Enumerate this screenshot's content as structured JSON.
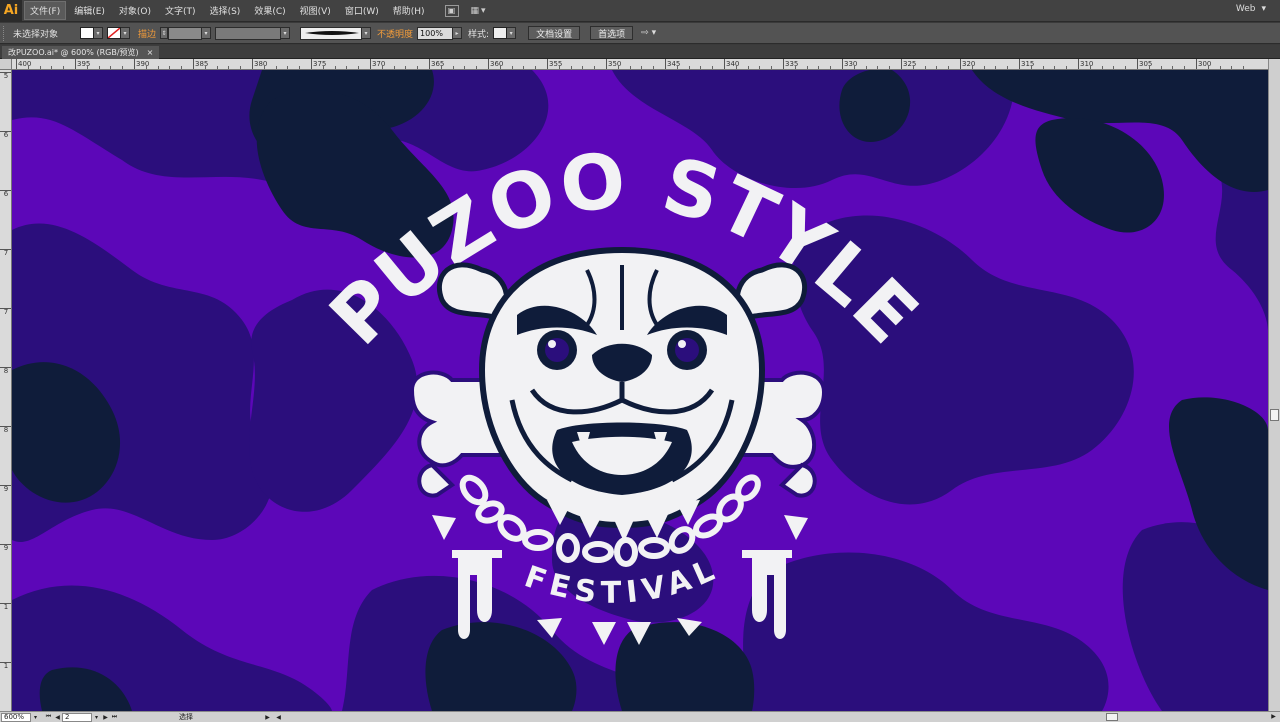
{
  "app": {
    "logo": "Ai"
  },
  "menu": {
    "items": [
      "文件(F)",
      "编辑(E)",
      "对象(O)",
      "文字(T)",
      "选择(S)",
      "效果(C)",
      "视图(V)",
      "窗口(W)",
      "帮助(H)"
    ],
    "active_index": 0,
    "workspace": "Web"
  },
  "control": {
    "selection_label": "未选择对象",
    "stroke_label": "描边",
    "opacity_label": "不透明度",
    "opacity_value": "100%",
    "style_label": "样式:",
    "doc_setup_button": "文档设置",
    "preferences_button": "首选项"
  },
  "tab": {
    "title": "改PUZOO.ai* @ 600% (RGB/预览)",
    "close_glyph": "×"
  },
  "ruler": {
    "h_labels": [
      "400",
      "395",
      "390",
      "385",
      "380",
      "375",
      "370",
      "365",
      "360",
      "355",
      "350",
      "345",
      "340",
      "335",
      "330",
      "325",
      "320",
      "315",
      "310",
      "305",
      "300"
    ],
    "v_labels": [
      "5",
      "6",
      "6",
      "7",
      "7",
      "8",
      "8",
      "9",
      "9",
      "1",
      "1",
      "1"
    ]
  },
  "artwork": {
    "headline": "PUZOO STYLE",
    "subline": "FESTIVAL",
    "colors": {
      "background": "#5c07b8",
      "camo_mid": "#2b0e7c",
      "camo_dark": "#0f1c3a",
      "ink": "#f2f2f4"
    }
  },
  "status": {
    "zoom": "600%",
    "artboard": "2",
    "tool": "选择"
  }
}
